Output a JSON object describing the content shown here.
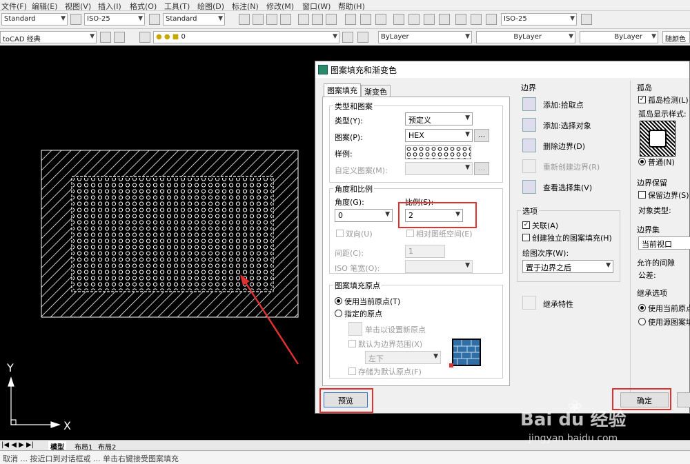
{
  "menu": [
    "文件(F)",
    "编辑(E)",
    "视图(V)",
    "插入(I)",
    "格式(O)",
    "工具(T)",
    "绘图(D)",
    "标注(N)",
    "修改(M)",
    "窗口(W)",
    "帮助(H)"
  ],
  "toolbar1": {
    "text_style": "Standard",
    "dim_style": "ISO-25",
    "table_style": "Standard",
    "mleader_style": "ISO-25"
  },
  "toolbar2": {
    "workspace": "toCAD 经典",
    "layer": "0",
    "color": "ByLayer",
    "linetype": "ByLayer",
    "lineweight": "ByLayer",
    "plotstyle": "随颜色"
  },
  "ucs": {
    "y": "Y",
    "x": "X"
  },
  "layout_tabs": [
    "模型",
    "布局1",
    "布局2"
  ],
  "command_line": "取消 ... 按近口到对话框或 ... 单击右键接受图案填充",
  "dialog": {
    "title": "图案填充和渐变色",
    "tabs": [
      "图案填充",
      "渐变色"
    ],
    "type_pattern": {
      "group": "类型和图案",
      "type_label": "类型(Y):",
      "type_value": "预定义",
      "pattern_label": "图案(P):",
      "pattern_value": "HEX",
      "sample_label": "样例:",
      "custom_label": "自定义图案(M):"
    },
    "angle_scale": {
      "group": "角度和比例",
      "angle_label": "角度(G):",
      "angle_value": "0",
      "scale_label": "比例(S):",
      "scale_value": "2",
      "double_label": "双向(U)",
      "relative_label": "相对图纸空间(E)",
      "spacing_label": "间距(C):",
      "spacing_value": "1",
      "iso_label": "ISO 笔宽(O):"
    },
    "origin": {
      "group": "图案填充原点",
      "current_label": "使用当前原点(T)",
      "specified_label": "指定的原点",
      "click_label": "单击以设置新原点",
      "default_extent_label": "默认为边界范围(X)",
      "extent_value": "左下",
      "store_label": "存储为默认原点(F)"
    },
    "boundary": {
      "group": "边界",
      "add_pick": "添加:拾取点",
      "add_select": "添加:选择对象",
      "remove": "删除边界(D)",
      "recreate": "重新创建边界(R)",
      "view": "查看选择集(V)"
    },
    "options": {
      "group": "选项",
      "associative": "关联(A)",
      "independent": "创建独立的图案填充(H)",
      "draw_order_label": "绘图次序(W):",
      "draw_order_value": "置于边界之后"
    },
    "inherit": "继承特性",
    "islands": {
      "group": "孤岛",
      "detect": "孤岛检测(L)",
      "style_label": "孤岛显示样式:",
      "normal": "普通(N)"
    },
    "retain": {
      "group": "边界保留",
      "retain_label": "保留边界(S)",
      "object_type": "对象类型:"
    },
    "boundary_set": {
      "group": "边界集",
      "value": "当前视口"
    },
    "gap": {
      "group": "允许的间隙",
      "tolerance": "公差:"
    },
    "inherit_opts": {
      "group": "继承选项",
      "use_current": "使用当前原点",
      "use_source": "使用源图案填"
    },
    "preview": "预览",
    "ok": "确定"
  },
  "watermark": {
    "brand": "Bai du 经验",
    "url": "jingyan.baidu.com"
  }
}
